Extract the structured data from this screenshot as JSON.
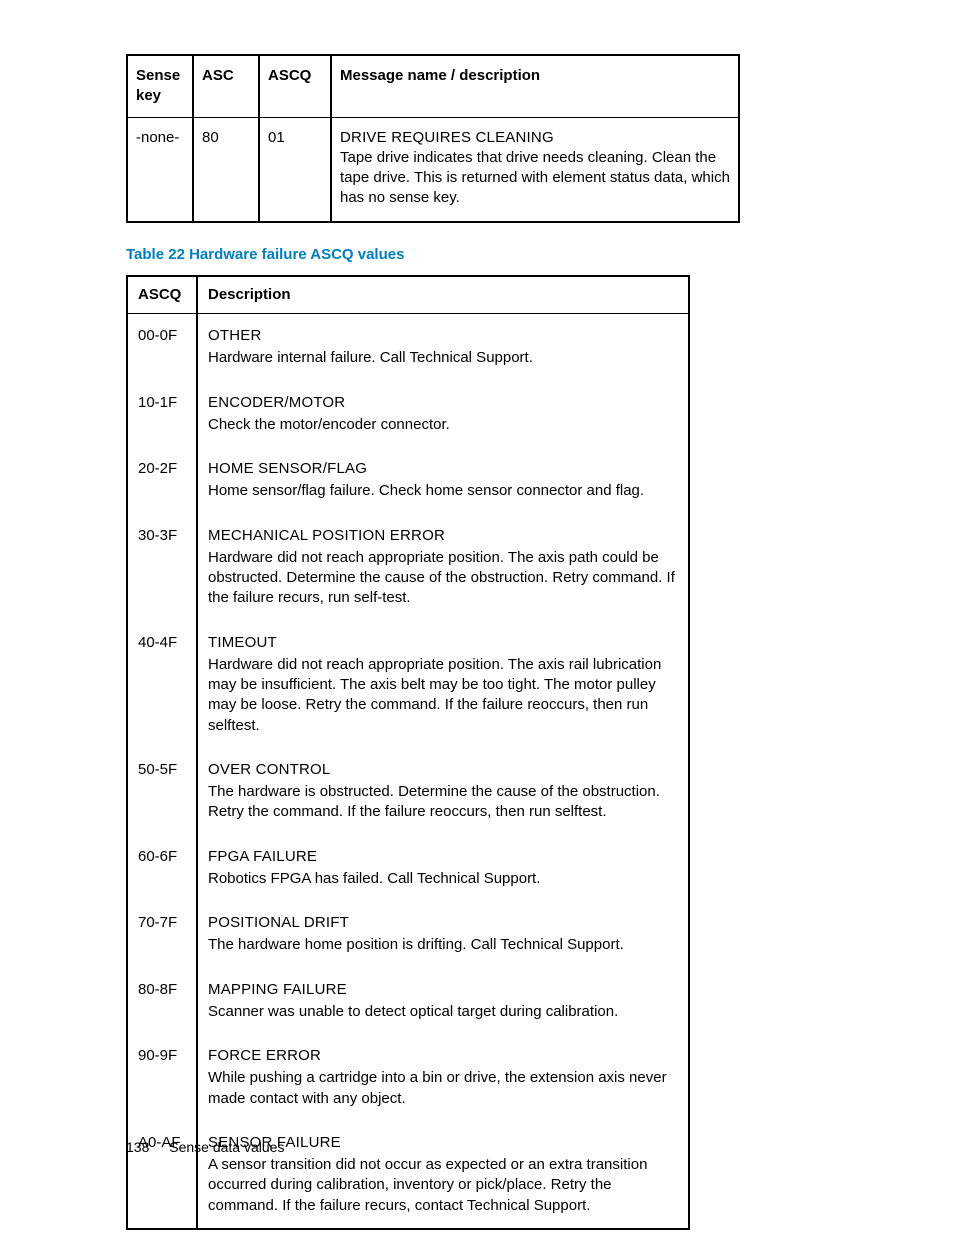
{
  "table1": {
    "headers": {
      "c1": "Sense key",
      "c2": "ASC",
      "c3": "ASCQ",
      "c4": "Message name / description"
    },
    "row": {
      "sense": "-none-",
      "asc": "80",
      "ascq": "01",
      "title": "DRIVE REQUIRES CLEANING",
      "desc": "Tape drive indicates that drive needs cleaning. Clean the tape drive. This is returned with element status data, which has no sense key."
    }
  },
  "caption": "Table 22 Hardware failure ASCQ values",
  "table2": {
    "headers": {
      "c1": "ASCQ",
      "c2": "Description"
    },
    "rows": [
      {
        "ascq": "00-0F",
        "title": "OTHER",
        "desc": "Hardware internal failure. Call Technical Support."
      },
      {
        "ascq": "10-1F",
        "title": "ENCODER/MOTOR",
        "desc": "Check the motor/encoder connector."
      },
      {
        "ascq": "20-2F",
        "title": "HOME SENSOR/FLAG",
        "desc": "Home sensor/flag failure. Check home sensor connector and flag."
      },
      {
        "ascq": "30-3F",
        "title": "MECHANICAL POSITION ERROR",
        "desc": "Hardware did not reach appropriate position. The axis path could be obstructed. Determine the cause of the obstruction. Retry command. If the failure recurs, run self-test."
      },
      {
        "ascq": "40-4F",
        "title": "TIMEOUT",
        "desc": "Hardware did not reach appropriate position. The axis rail lubrication may be insufficient. The axis belt may be too tight. The motor pulley may be loose. Retry the command. If the failure reoccurs, then run selftest."
      },
      {
        "ascq": "50-5F",
        "title": "OVER CONTROL",
        "desc": "The hardware is obstructed. Determine the cause of the obstruction. Retry the command. If the failure reoccurs, then run selftest."
      },
      {
        "ascq": "60-6F",
        "title": "FPGA FAILURE",
        "desc": "Robotics FPGA has failed. Call Technical Support."
      },
      {
        "ascq": "70-7F",
        "title": "POSITIONAL DRIFT",
        "desc": "The hardware home position is drifting. Call Technical Support."
      },
      {
        "ascq": "80-8F",
        "title": "MAPPING FAILURE",
        "desc": "Scanner was unable to detect optical target during calibration."
      },
      {
        "ascq": "90-9F",
        "title": "FORCE ERROR",
        "desc": "While pushing a cartridge into a bin or drive, the extension axis never made contact with any object."
      },
      {
        "ascq": "A0-AF",
        "title": "SENSOR FAILURE",
        "desc": "A sensor transition did not occur as expected or an extra transition occurred during calibration, inventory or pick/place. Retry the command. If the failure recurs, contact Technical Support."
      }
    ]
  },
  "footer": {
    "page": "138",
    "section": "Sense data values"
  }
}
